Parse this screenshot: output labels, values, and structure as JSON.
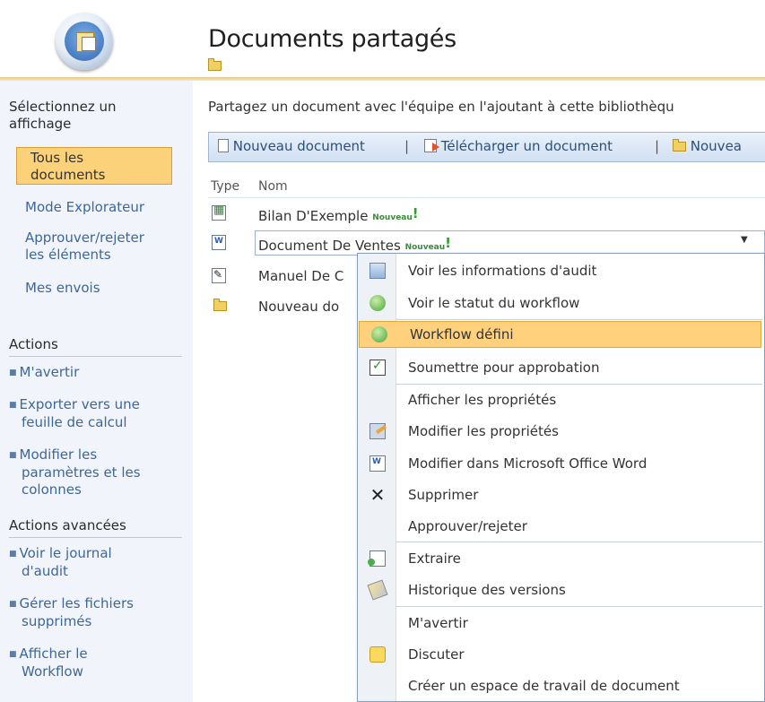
{
  "header": {
    "title": "Documents partagés",
    "title_icon": "folder-icon",
    "logo_icon": "site-logo-icon"
  },
  "left_nav": {
    "view_heading": "Sélectionnez un affichage",
    "views": [
      {
        "label_line1": "Tous les",
        "label_line2": "documents",
        "selected": true
      },
      {
        "label_line1": "Mode Explorateur",
        "label_line2": ""
      },
      {
        "label_line1": "Approuver/rejeter",
        "label_line2": "les éléments"
      },
      {
        "label_line1": "Mes envois",
        "label_line2": ""
      }
    ],
    "actions_heading": "Actions",
    "actions": [
      {
        "line1": "M'avertir",
        "line2": "",
        "line3": ""
      },
      {
        "line1": "Exporter vers une",
        "line2": "feuille de calcul",
        "line3": ""
      },
      {
        "line1": "Modifier les",
        "line2": "paramètres et les",
        "line3": "colonnes"
      }
    ],
    "advanced_heading": "Actions avancées",
    "advanced_actions": [
      {
        "line1": "Voir le journal",
        "line2": "d'audit"
      },
      {
        "line1": "Gérer les fichiers",
        "line2": "supprimés"
      },
      {
        "line1": "Afficher le",
        "line2": "Workflow"
      }
    ]
  },
  "main": {
    "intro": "Partagez un document avec l'équipe en l'ajoutant à cette bibliothèqu",
    "toolbar": {
      "new_document": "Nouveau document",
      "upload_document": "Télécharger un document",
      "new_folder_partial": "Nouvea",
      "separator": "|"
    },
    "columns": {
      "type": "Type",
      "name": "Nom"
    },
    "rows": [
      {
        "name": "Bilan D'Exemple",
        "badge": "Nouveau",
        "mark": "!",
        "icon": "excel-file-icon"
      },
      {
        "name": "Document De Ventes",
        "badge": "Nouveau",
        "mark": "!",
        "icon": "word-file-icon"
      },
      {
        "name": "Manuel De C",
        "badge": "",
        "mark": "",
        "icon": "infopath-file-icon"
      },
      {
        "name": "Nouveau do",
        "badge": "",
        "mark": "",
        "icon": "folder-icon"
      }
    ]
  },
  "context_menu": {
    "items": [
      {
        "label": "Voir les informations d'audit",
        "icon": "audit-icon"
      },
      {
        "label": "Voir le statut du workflow",
        "icon": "workflow-status-icon"
      },
      {
        "label": "Workflow défini",
        "icon": "workflow-icon",
        "highlighted": true
      },
      {
        "label": "Soumettre pour approbation",
        "icon": "submit-approval-icon"
      },
      {
        "label": "Afficher les propriétés",
        "icon": ""
      },
      {
        "label": "Modifier les propriétés",
        "icon": "edit-properties-icon"
      },
      {
        "label": "Modifier dans Microsoft Office Word",
        "icon": "word-edit-icon"
      },
      {
        "label": "Supprimer",
        "icon": "delete-icon"
      },
      {
        "label": "Approuver/rejeter",
        "icon": ""
      },
      {
        "label": "Extraire",
        "icon": "checkout-icon"
      },
      {
        "label": "Historique des versions",
        "icon": "version-history-icon"
      },
      {
        "label": "M'avertir",
        "icon": ""
      },
      {
        "label": "Discuter",
        "icon": "discuss-icon"
      },
      {
        "label": "Créer un espace de travail de document",
        "icon": ""
      }
    ]
  },
  "colors": {
    "nav_bg": "#f1f5fb",
    "link": "#3d6799",
    "highlight": "#ffd17d",
    "toolbar": "#dce7f5"
  }
}
